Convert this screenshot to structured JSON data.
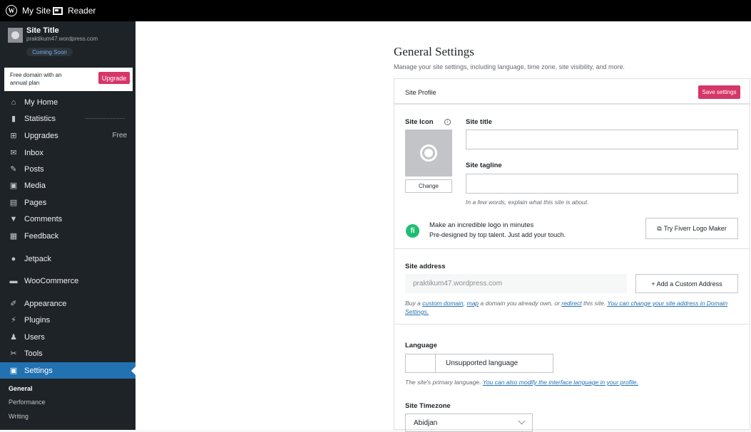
{
  "topbar": {
    "my_site": "My Site",
    "reader": "Reader"
  },
  "site": {
    "title": "Site Title",
    "url": "praktikum47.wordpress.com",
    "status": "Coming Soon"
  },
  "promo": {
    "text": "Free domain with an annual plan",
    "button": "Upgrade"
  },
  "nav": [
    {
      "label": "My Home",
      "icon": "home-icon"
    },
    {
      "label": "Statistics",
      "icon": "bar-chart-icon"
    },
    {
      "label": "Upgrades",
      "icon": "cart-icon",
      "badge": "Free"
    },
    {
      "label": "Inbox",
      "icon": "mail-icon"
    },
    {
      "label": "Posts",
      "icon": "pin-icon"
    },
    {
      "label": "Media",
      "icon": "media-icon"
    },
    {
      "label": "Pages",
      "icon": "page-icon"
    },
    {
      "label": "Comments",
      "icon": "comment-icon"
    },
    {
      "label": "Feedback",
      "icon": "feedback-icon"
    },
    {
      "label": "Jetpack",
      "icon": "jetpack-icon"
    },
    {
      "label": "WooCommerce",
      "icon": "woo-icon"
    },
    {
      "label": "Appearance",
      "icon": "brush-icon"
    },
    {
      "label": "Plugins",
      "icon": "plug-icon"
    },
    {
      "label": "Users",
      "icon": "user-icon"
    },
    {
      "label": "Tools",
      "icon": "wrench-icon"
    },
    {
      "label": "Settings",
      "icon": "settings-icon"
    }
  ],
  "submenu": [
    "General",
    "Performance",
    "Writing"
  ],
  "page": {
    "title": "General Settings",
    "subtitle": "Manage your site settings, including language, time zone, site visibility, and more."
  },
  "profile": {
    "heading": "Site Profile",
    "save_button": "Save settings",
    "site_icon_label": "Site Icon",
    "change_button": "Change",
    "site_title_label": "Site title",
    "site_title_value": "",
    "tagline_label": "Site tagline",
    "tagline_value": "",
    "tagline_hint": "In a few words, explain what this site is about."
  },
  "fiverr": {
    "title": "Make an incredible logo in minutes",
    "subtitle": "Pre-designed by top talent. Just add your touch.",
    "button": "Try Fiverr Logo Maker"
  },
  "address": {
    "label": "Site address",
    "value": "praktikum47.wordpress.com",
    "add_button": "+ Add a Custom Address",
    "hint_prefix": "Buy a ",
    "hint_link1": "custom domain",
    "hint_mid1": ", ",
    "hint_link2": "map",
    "hint_mid2": " a domain you already own, or ",
    "hint_link3": "redirect",
    "hint_mid3": " this site. ",
    "hint_link4": "You can change your site address in Domain Settings."
  },
  "language": {
    "label": "Language",
    "value": "Unsupported language",
    "hint_prefix": "The site's primary language. ",
    "hint_link": "You can also modify the interface language in your profile."
  },
  "timezone": {
    "label": "Site Timezone",
    "value": "Abidjan"
  }
}
